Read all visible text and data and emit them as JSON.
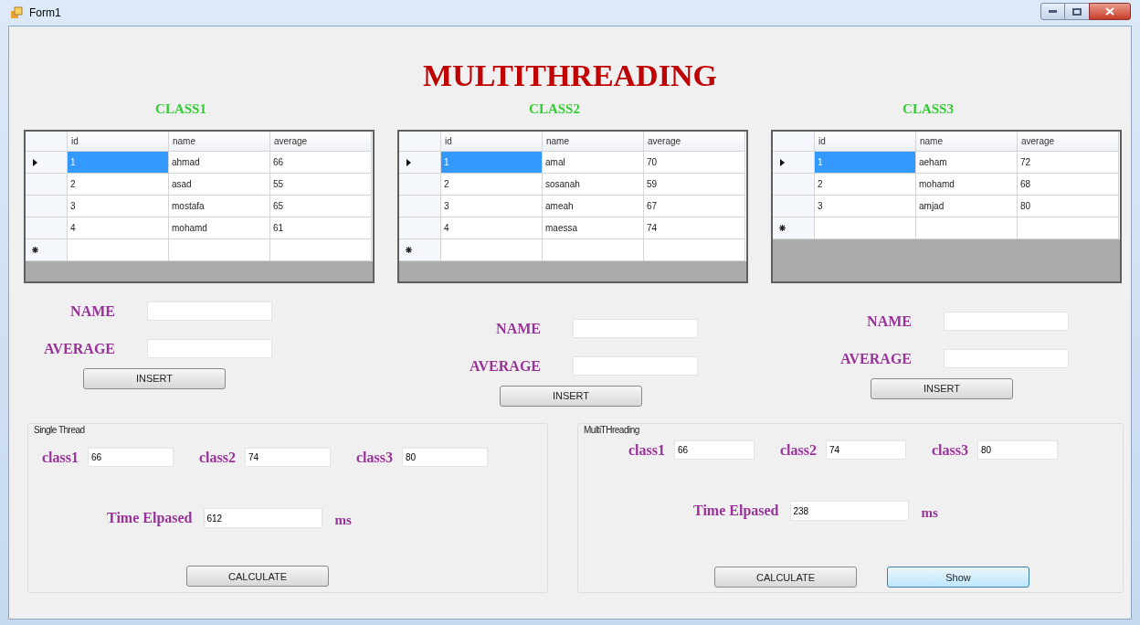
{
  "window": {
    "title": "Form1"
  },
  "heading": "MULTITHREADING",
  "classes": [
    {
      "title": "CLASS1",
      "table": {
        "columns": [
          "id",
          "name",
          "average"
        ],
        "rows": [
          {
            "cells": [
              "1",
              "ahmad",
              "66"
            ],
            "selected": true
          },
          {
            "cells": [
              "2",
              "asad",
              "55"
            ],
            "selected": false
          },
          {
            "cells": [
              "3",
              "mostafa",
              "65"
            ],
            "selected": false
          },
          {
            "cells": [
              "4",
              "mohamd",
              "61"
            ],
            "selected": false
          }
        ],
        "new_row": true
      },
      "form": {
        "fields": [
          {
            "label": "NAME"
          },
          {
            "label": "AVERAGE"
          }
        ],
        "button": "INSERT"
      }
    },
    {
      "title": "CLASS2",
      "table": {
        "columns": [
          "id",
          "name",
          "average"
        ],
        "rows": [
          {
            "cells": [
              "1",
              "amal",
              "70"
            ],
            "selected": true
          },
          {
            "cells": [
              "2",
              "sosanah",
              "59"
            ],
            "selected": false
          },
          {
            "cells": [
              "3",
              "ameah",
              "67"
            ],
            "selected": false
          },
          {
            "cells": [
              "4",
              "maessa",
              "74"
            ],
            "selected": false
          }
        ],
        "new_row": true
      },
      "form": {
        "fields": [
          {
            "label": "NAME"
          },
          {
            "label": "AVERAGE"
          }
        ],
        "button": "INSERT"
      }
    },
    {
      "title": "CLASS3",
      "table": {
        "columns": [
          "id",
          "name",
          "average"
        ],
        "rows": [
          {
            "cells": [
              "1",
              "aeham",
              "72"
            ],
            "selected": true
          },
          {
            "cells": [
              "2",
              "mohamd",
              "68"
            ],
            "selected": false
          },
          {
            "cells": [
              "3",
              "amjad",
              "80"
            ],
            "selected": false
          }
        ],
        "new_row": true
      },
      "form": {
        "fields": [
          {
            "label": "NAME"
          },
          {
            "label": "AVERAGE"
          }
        ],
        "button": "INSERT"
      }
    }
  ],
  "groups": [
    {
      "title": "Single Thread",
      "results": [
        {
          "label": "class1",
          "value": "66"
        },
        {
          "label": "class2",
          "value": "74"
        },
        {
          "label": "class3",
          "value": "80"
        }
      ],
      "time": {
        "label": "Time Elpased",
        "value": "612",
        "unit": "ms"
      },
      "buttons": [
        {
          "label": "CALCULATE",
          "focused": false
        }
      ]
    },
    {
      "title": "MultiTHreading",
      "results": [
        {
          "label": "class1",
          "value": "66"
        },
        {
          "label": "class2",
          "value": "74"
        },
        {
          "label": "class3",
          "value": "80"
        }
      ],
      "time": {
        "label": "Time Elpased",
        "value": "238",
        "unit": "ms"
      },
      "buttons": [
        {
          "label": "CALCULATE",
          "focused": false
        },
        {
          "label": "Show",
          "focused": true
        }
      ]
    }
  ]
}
